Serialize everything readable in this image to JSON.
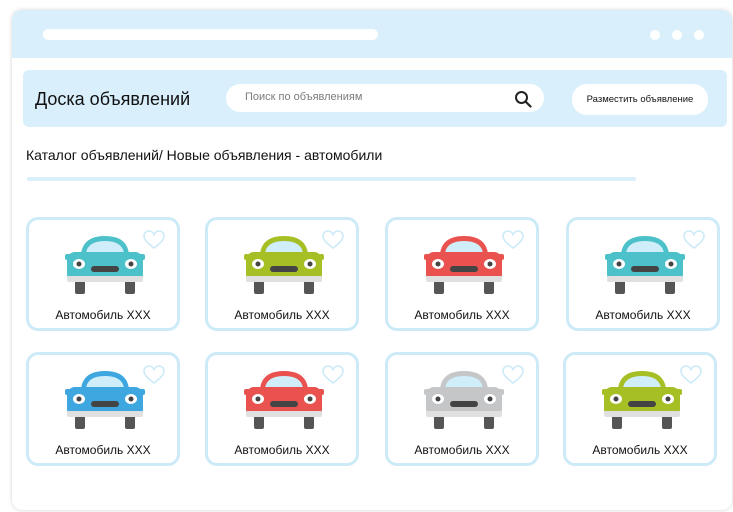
{
  "header": {
    "brand": "Доска объявлений",
    "search_placeholder": "Поиск по объявлениям",
    "post_button": "Разместить объявление"
  },
  "breadcrumb": "Каталог объявлений/ Новые объявления - автомобили",
  "listings": [
    {
      "label": "Автомобиль XXX",
      "icon": "car-icon",
      "color": "#4cc1c9"
    },
    {
      "label": "Автомобиль XXX",
      "icon": "car-icon",
      "color": "#a6bf24"
    },
    {
      "label": "Автомобиль XXX",
      "icon": "car-icon",
      "color": "#e9524f"
    },
    {
      "label": "Автомобиль XXX",
      "icon": "car-icon",
      "color": "#4cc1c9"
    },
    {
      "label": "Автомобиль XXX",
      "icon": "car-icon",
      "color": "#3ea7e0"
    },
    {
      "label": "Автомобиль XXX",
      "icon": "car-icon",
      "color": "#e9524f"
    },
    {
      "label": "Автомобиль XXX",
      "icon": "car-icon",
      "color": "#c4c6c8"
    },
    {
      "label": "Автомобиль XXX",
      "icon": "car-icon",
      "color": "#a6bf24"
    }
  ],
  "colors": {
    "accent": "#d9f0fc",
    "card_border": "#cdeaf8"
  }
}
